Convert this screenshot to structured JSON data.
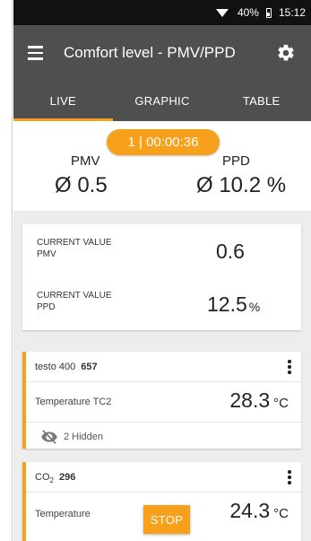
{
  "status_bar": {
    "battery_percent": "40%",
    "time": "15:12"
  },
  "app_bar": {
    "title": "Comfort level - PMV/PPD"
  },
  "tabs": [
    {
      "label": "LIVE",
      "active": true
    },
    {
      "label": "GRAPHIC",
      "active": false
    },
    {
      "label": "TABLE",
      "active": false
    }
  ],
  "summary": {
    "timer": "1 | 00:00:36",
    "pmv_label": "PMV",
    "pmv_value": "Ø 0.5",
    "ppd_label": "PPD",
    "ppd_value": "Ø 10.2 %"
  },
  "current_values": [
    {
      "label_line1": "CURRENT VALUE",
      "label_line2": "PMV",
      "value": "0.6",
      "unit": ""
    },
    {
      "label_line1": "CURRENT VALUE",
      "label_line2": "PPD",
      "value": "12.5",
      "unit": "%"
    }
  ],
  "sensors": [
    {
      "probe": "testo 400",
      "probe_id": "657",
      "parameter": "Temperature TC2",
      "value": "28.3",
      "unit": "°C",
      "hidden_text": "2 Hidden"
    },
    {
      "probe_prefix": "CO",
      "probe_sub": "2",
      "probe_id": "296",
      "parameter": "Temperature",
      "value": "24.3",
      "unit": "°C"
    }
  ],
  "stop_button": {
    "label": "STOP"
  },
  "colors": {
    "accent": "#f7a01c",
    "app_bar": "#4f4f4f",
    "status_bar": "#111111"
  },
  "icons": [
    "wifi-icon",
    "battery-icon",
    "menu-icon",
    "gear-icon",
    "kebab-menu-icon",
    "eye-off-icon"
  ]
}
